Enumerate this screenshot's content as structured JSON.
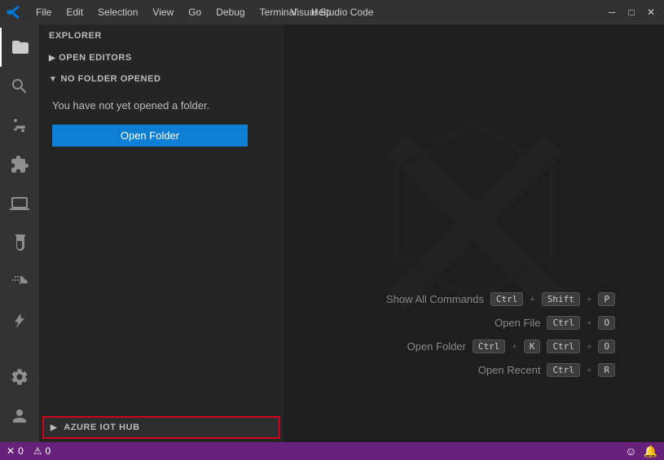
{
  "titlebar": {
    "logo": "vscode-icon",
    "title": "Visual Studio Code",
    "menu": [
      "File",
      "Edit",
      "Selection",
      "View",
      "Go",
      "Debug",
      "Terminal",
      "Help"
    ],
    "controls": [
      "minimize",
      "maximize",
      "close"
    ]
  },
  "activity_bar": {
    "items": [
      {
        "name": "explorer",
        "icon": "files-icon"
      },
      {
        "name": "search",
        "icon": "search-icon"
      },
      {
        "name": "source-control",
        "icon": "source-control-icon"
      },
      {
        "name": "extensions",
        "icon": "extensions-icon"
      },
      {
        "name": "remote-explorer",
        "icon": "remote-icon"
      },
      {
        "name": "test",
        "icon": "beaker-icon"
      },
      {
        "name": "docker",
        "icon": "docker-icon"
      },
      {
        "name": "azure",
        "icon": "azure-icon"
      }
    ],
    "bottom": [
      {
        "name": "settings",
        "icon": "gear-icon"
      },
      {
        "name": "accounts",
        "icon": "accounts-icon"
      }
    ]
  },
  "sidebar": {
    "header": "Explorer",
    "sections": [
      {
        "label": "Open Editors",
        "collapsed": true
      },
      {
        "label": "No Folder Opened",
        "collapsed": false
      }
    ],
    "no_folder_text": "You have not yet opened a folder.",
    "open_folder_button": "Open Folder"
  },
  "iot_hub": {
    "label": "AZURE IOT HUB",
    "chevron": "▶"
  },
  "editor": {
    "shortcuts": [
      {
        "label": "Show All Commands",
        "keys": [
          "Ctrl",
          "+",
          "Shift",
          "+",
          "P"
        ]
      },
      {
        "label": "Open File",
        "keys": [
          "Ctrl",
          "+",
          "O"
        ]
      },
      {
        "label": "Open Folder",
        "keys": [
          "Ctrl",
          "+",
          "K",
          "Ctrl",
          "+",
          "O"
        ]
      },
      {
        "label": "Open Recent",
        "keys": [
          "Ctrl",
          "+",
          "R"
        ]
      }
    ]
  },
  "statusbar": {
    "errors": "0",
    "warnings": "0",
    "right_icons": [
      "smiley-icon",
      "bell-icon"
    ]
  }
}
